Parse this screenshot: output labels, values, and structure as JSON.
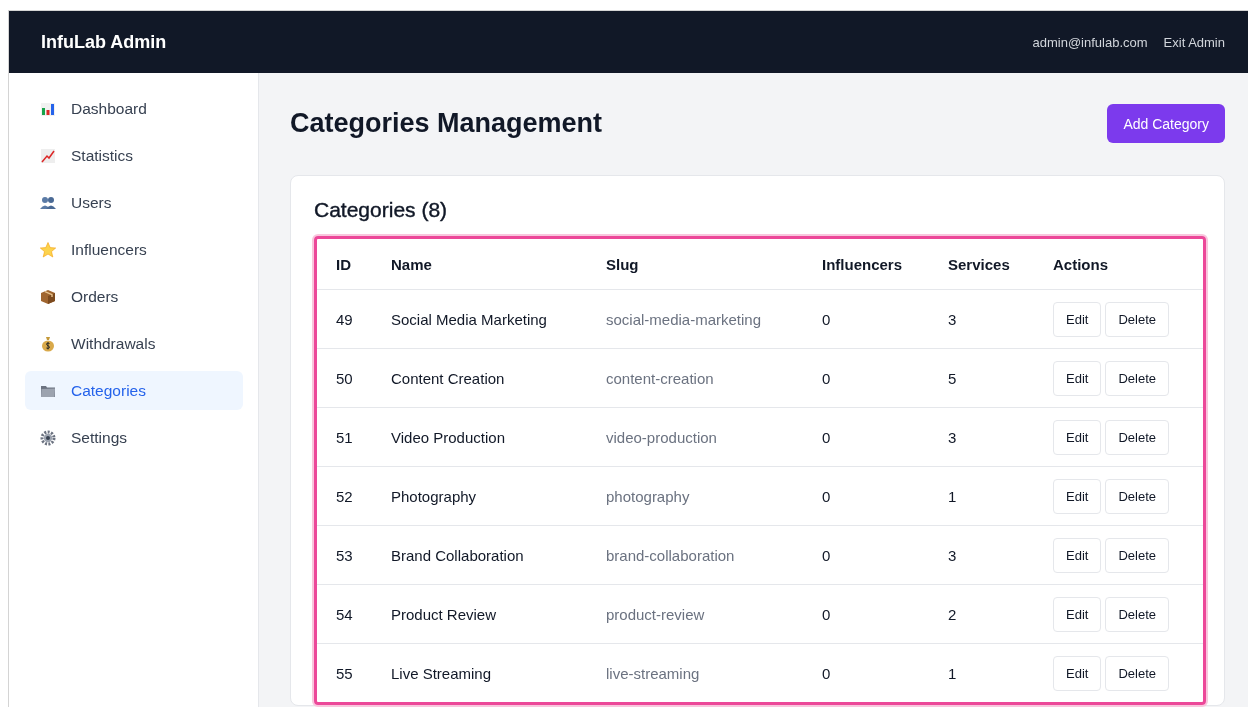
{
  "header": {
    "title": "InfuLab Admin",
    "user_email": "admin@infulab.com",
    "exit_link": "Exit Admin"
  },
  "sidebar": {
    "items": [
      {
        "label": "Dashboard",
        "selected": false
      },
      {
        "label": "Statistics",
        "selected": false
      },
      {
        "label": "Users",
        "selected": false
      },
      {
        "label": "Influencers",
        "selected": false
      },
      {
        "label": "Orders",
        "selected": false
      },
      {
        "label": "Withdrawals",
        "selected": false
      },
      {
        "label": "Categories",
        "selected": true
      },
      {
        "label": "Settings",
        "selected": false
      }
    ]
  },
  "page": {
    "title": "Categories Management",
    "add_button": "Add Category"
  },
  "card": {
    "title": "Categories (8)"
  },
  "table": {
    "columns": [
      "ID",
      "Name",
      "Slug",
      "Influencers",
      "Services",
      "Actions"
    ],
    "rows": [
      {
        "id": "49",
        "name": "Social Media Marketing",
        "slug": "social-media-marketing",
        "influencers": "0",
        "services": "3",
        "edit": "Edit",
        "delete": "Delete"
      },
      {
        "id": "50",
        "name": "Content Creation",
        "slug": "content-creation",
        "influencers": "0",
        "services": "5",
        "edit": "Edit",
        "delete": "Delete"
      },
      {
        "id": "51",
        "name": "Video Production",
        "slug": "video-production",
        "influencers": "0",
        "services": "3",
        "edit": "Edit",
        "delete": "Delete"
      },
      {
        "id": "52",
        "name": "Photography",
        "slug": "photography",
        "influencers": "0",
        "services": "1",
        "edit": "Edit",
        "delete": "Delete"
      },
      {
        "id": "53",
        "name": "Brand Collaboration",
        "slug": "brand-collaboration",
        "influencers": "0",
        "services": "3",
        "edit": "Edit",
        "delete": "Delete"
      },
      {
        "id": "54",
        "name": "Product Review",
        "slug": "product-review",
        "influencers": "0",
        "services": "2",
        "edit": "Edit",
        "delete": "Delete"
      },
      {
        "id": "55",
        "name": "Live Streaming",
        "slug": "live-streaming",
        "influencers": "0",
        "services": "1",
        "edit": "Edit",
        "delete": "Delete"
      }
    ]
  }
}
